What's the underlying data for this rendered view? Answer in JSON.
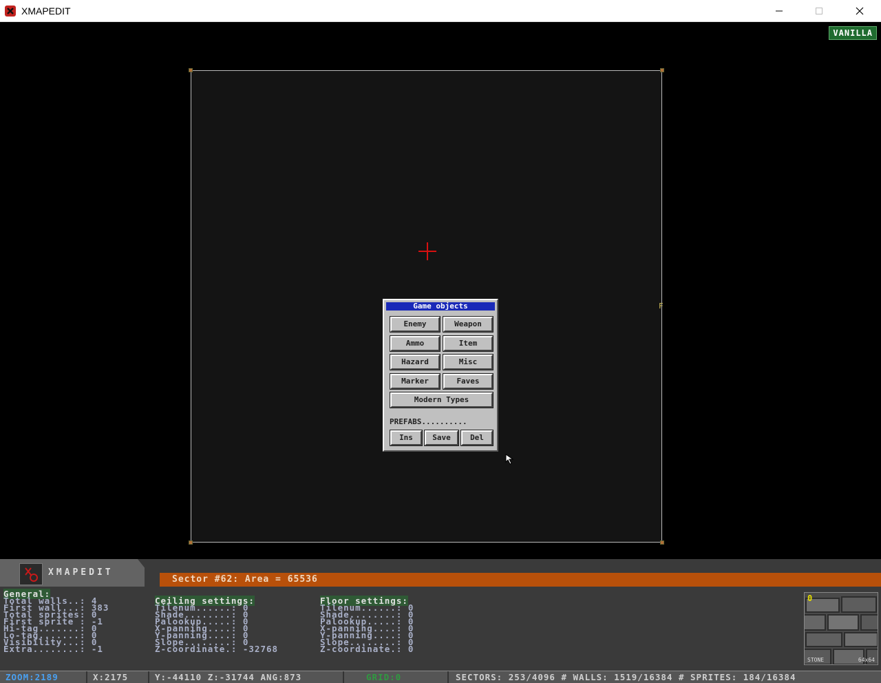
{
  "window": {
    "title": "XMAPEDIT"
  },
  "map": {
    "badge": "VANILLA",
    "wall_label": "F"
  },
  "dialog": {
    "title": "Game objects",
    "buttons": {
      "enemy": "Enemy",
      "weapon": "Weapon",
      "ammo": "Ammo",
      "item": "Item",
      "hazard": "Hazard",
      "misc": "Misc",
      "marker": "Marker",
      "faves": "Faves",
      "modern_types": "Modern Types"
    },
    "prefabs_label": "PREFABS..........",
    "prefab_buttons": {
      "ins": "Ins",
      "save": "Save",
      "del": "Del"
    }
  },
  "panel": {
    "logo_text": "XMAPEDIT",
    "sector_title": "Sector #62: Area = 65536",
    "general": {
      "heading": "General:",
      "lines": [
        "Total walls..: 4",
        "First wall...: 383",
        "Total sprites: 0",
        "First sprite : -1",
        "Hi-tag.......: 0",
        "Lo-tag.......: 0",
        "Visibility...: 0",
        "Extra........: -1"
      ]
    },
    "ceiling": {
      "heading": "Ceiling settings:",
      "lines": [
        "Tilenum......: 0",
        "Shade........: 0",
        "Palookup.....: 0",
        "X-panning....: 0",
        "Y-panning....: 0",
        "Slope........: 0",
        "Z-coordinate.: -32768"
      ]
    },
    "floor": {
      "heading": "Floor settings:",
      "lines": [
        "Tilenum......: 0",
        "Shade........: 0",
        "Palookup.....: 0",
        "X-panning....: 0",
        "Y-panning....: 0",
        "Slope........: 0",
        "Z-coordinate.: 0"
      ]
    },
    "texture": {
      "number": "0",
      "name": "STONE",
      "size": "64x64"
    }
  },
  "status": {
    "zoom": "ZOOM:2189",
    "x": "X:2175",
    "yzang": "Y:-44110 Z:-31744 ANG:873",
    "grid": "GRID:0",
    "counts": "SECTORS: 253/4096 # WALLS: 1519/16384 # SPRITES: 184/16384"
  },
  "colors": {
    "dialog_title": "#1a2ab8",
    "sector_bar": "#b8500a",
    "badge": "#1f6b2f"
  }
}
